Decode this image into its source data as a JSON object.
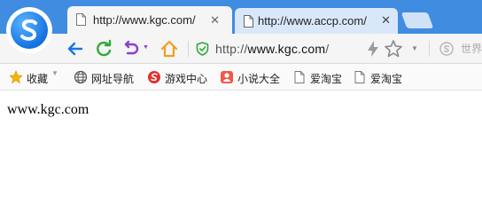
{
  "tabs": [
    {
      "title": "http://www.kgc.com/",
      "active": true
    },
    {
      "title": "http://www.accp.com/",
      "active": false
    }
  ],
  "address_bar": {
    "url_prefix": "http://",
    "url_host": "www.kgc.com",
    "url_suffix": "/"
  },
  "search": {
    "placeholder": "世界"
  },
  "bookmarks": [
    {
      "label": "收藏",
      "icon": "star-icon"
    },
    {
      "label": "网址导航",
      "icon": "globe-icon"
    },
    {
      "label": "游戏中心",
      "icon": "game-icon"
    },
    {
      "label": "小说大全",
      "icon": "novel-icon"
    },
    {
      "label": "爱淘宝",
      "icon": "page-icon"
    },
    {
      "label": "爱淘宝",
      "icon": "page-icon"
    }
  ],
  "page": {
    "body_text": "www.kgc.com"
  },
  "colors": {
    "titlebar": "#3f8ce0",
    "back": "#1a73e8",
    "refresh": "#2fa93a",
    "undo": "#8a3fd1",
    "home": "#f0a020"
  }
}
